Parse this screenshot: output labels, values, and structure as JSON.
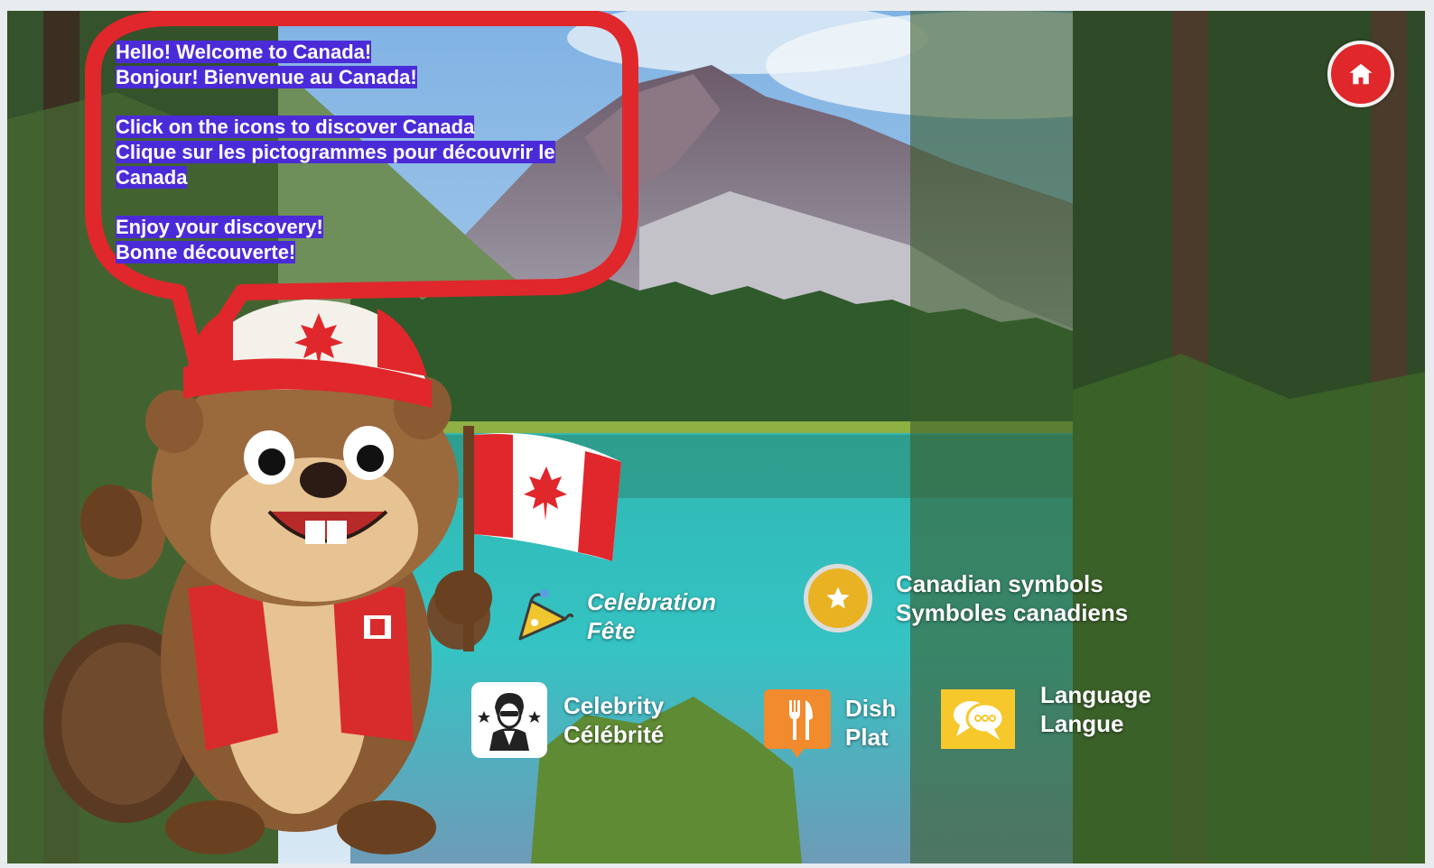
{
  "welcome": {
    "greeting_en": "Hello! Welcome to Canada!",
    "greeting_fr": "Bonjour! Bienvenue au Canada!",
    "instruction_en": "Click on the icons to discover Canada",
    "instruction_fr_1": "Clique sur les pictogrammes pour découvrir le",
    "instruction_fr_2": "Canada",
    "enjoy_en": "Enjoy your discovery!",
    "enjoy_fr": "Bonne découverte!"
  },
  "home": {
    "icon": "home-icon"
  },
  "nav": {
    "celebration": {
      "label_en": "Celebration",
      "label_fr": "Fête",
      "icon": "party-horn-icon"
    },
    "symbols": {
      "label_en": "Canadian symbols",
      "label_fr": "Symboles canadiens",
      "icon": "star-icon"
    },
    "celebrity": {
      "label_en": "Celebrity",
      "label_fr": "Célébrité",
      "icon": "celebrity-icon"
    },
    "dish": {
      "label_en": "Dish",
      "label_fr": "Plat",
      "icon": "fork-knife-icon"
    },
    "language": {
      "label_en": "Language",
      "label_fr": "Langue",
      "icon": "speech-bubbles-icon"
    }
  },
  "colors": {
    "bubble_border": "#e0272b",
    "text_highlight": "#4b2bd8",
    "home_button": "#e0272b",
    "dish_icon_bg": "#f28a2e",
    "symbols_icon_bg": "#e8b223",
    "language_icon_bg": "#f6c82c"
  }
}
